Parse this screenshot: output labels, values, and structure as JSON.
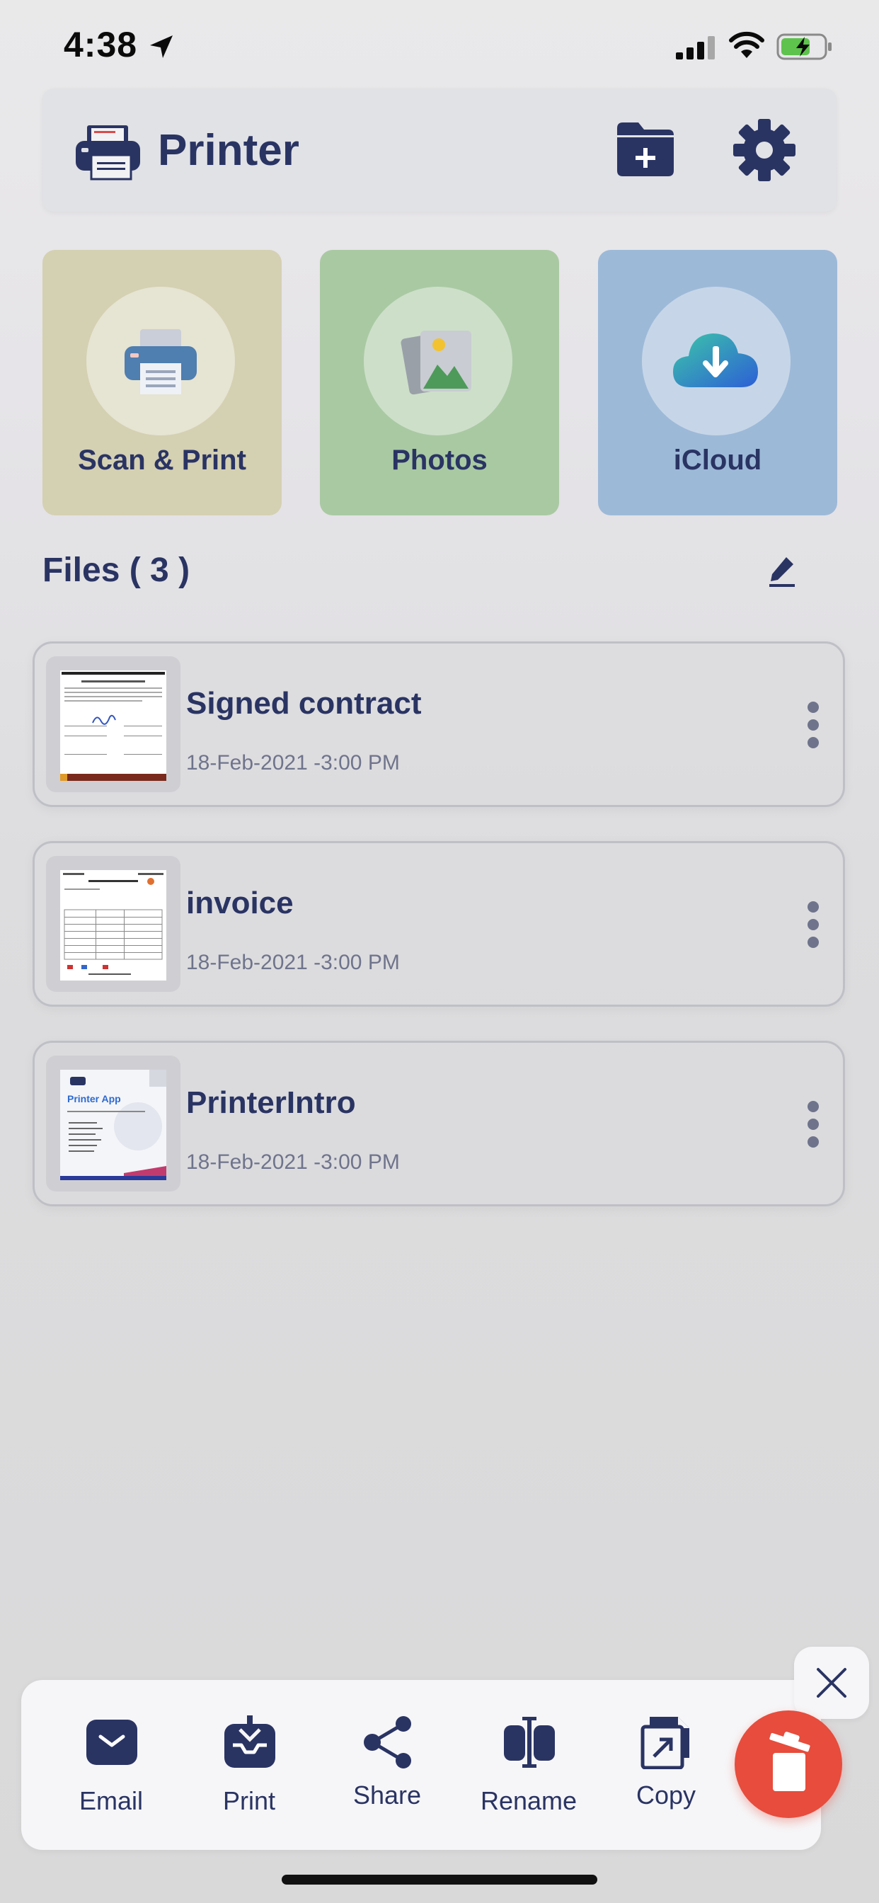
{
  "status_bar": {
    "time": "4:38"
  },
  "header": {
    "title": "Printer",
    "icons": [
      "printer-icon",
      "folder-add-icon",
      "gear-icon"
    ]
  },
  "tiles": [
    {
      "label": "Scan & Print",
      "icon": "printer-icon",
      "color": "#d4d0b2"
    },
    {
      "label": "Photos",
      "icon": "photos-icon",
      "color": "#a9c9a3"
    },
    {
      "label": "iCloud",
      "icon": "icloud-download-icon",
      "color": "#9db9d8"
    }
  ],
  "files": {
    "title": "Files ( 3 )",
    "items": [
      {
        "name": "Signed contract",
        "date": "18-Feb-2021 -3:00 PM"
      },
      {
        "name": "invoice",
        "date": "18-Feb-2021 -3:00 PM"
      },
      {
        "name": "PrinterIntro",
        "date": "18-Feb-2021 -3:00 PM"
      }
    ]
  },
  "thumbnails": {
    "printer_intro_title": "Printer App"
  },
  "toolbar": {
    "items": [
      {
        "label": "Email",
        "icon": "email-icon"
      },
      {
        "label": "Print",
        "icon": "print-tray-icon"
      },
      {
        "label": "Share",
        "icon": "share-icon"
      },
      {
        "label": "Rename",
        "icon": "rename-icon"
      },
      {
        "label": "Copy",
        "icon": "copy-icon"
      }
    ]
  },
  "colors": {
    "primary": "#2a3463",
    "delete": "#e74c3c"
  }
}
